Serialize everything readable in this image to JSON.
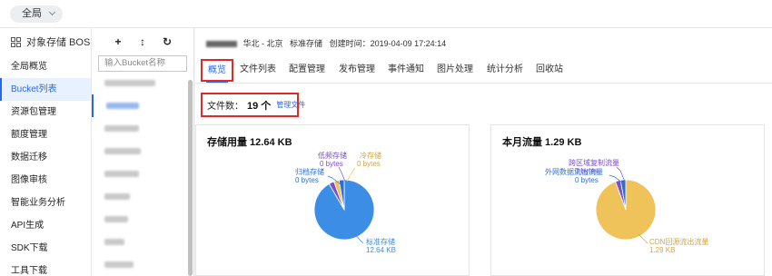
{
  "topbar": {
    "region": "全局"
  },
  "nav": {
    "title": "对象存储 BOS",
    "items": [
      {
        "label": "全局概览"
      },
      {
        "label": "Bucket列表"
      },
      {
        "label": "资源包管理"
      },
      {
        "label": "额度管理"
      },
      {
        "label": "数据迁移"
      },
      {
        "label": "图像审核"
      },
      {
        "label": "智能业务分析"
      },
      {
        "label": "API生成"
      },
      {
        "label": "SDK下载"
      },
      {
        "label": "工具下载"
      }
    ]
  },
  "bucket_panel": {
    "toolbar": {
      "add": "+",
      "sort": "↕",
      "refresh": "↻"
    },
    "search_placeholder": "输入Bucket名称"
  },
  "bucket_info": {
    "region": "华北 - 北京",
    "storage_class": "标准存储",
    "created": "创建时间：2019-04-09 17:24:14"
  },
  "tabs": [
    {
      "label": "概览"
    },
    {
      "label": "文件列表"
    },
    {
      "label": "配置管理"
    },
    {
      "label": "发布管理"
    },
    {
      "label": "事件通知"
    },
    {
      "label": "图片处理"
    },
    {
      "label": "统计分析"
    },
    {
      "label": "回收站"
    }
  ],
  "file_count": {
    "label": "文件数：",
    "value": "19 个",
    "link": "管理文件"
  },
  "colors": {
    "accent": "#2468f2",
    "highlight": "#e02a2a",
    "blue": "#3b8de6",
    "purple": "#7b4fc9",
    "gold": "#efc25a"
  },
  "chart_data": [
    {
      "type": "pie",
      "title": "存储用量 12.64 KB",
      "slices": [
        {
          "name": "标准存储",
          "value_label": "12.64 KB",
          "value": 12.64,
          "color": "#3b8de6"
        },
        {
          "name": "低频存储",
          "value_label": "0 bytes",
          "value": 0,
          "color": "#7b4fc9"
        },
        {
          "name": "冷存储",
          "value_label": "0 bytes",
          "value": 0,
          "color": "#efc25a"
        },
        {
          "name": "归档存储",
          "value_label": "0 bytes",
          "value": 0,
          "color": "#2c6fd1"
        }
      ]
    },
    {
      "type": "pie",
      "title": "本月流量 1.29 KB",
      "slices": [
        {
          "name": "CDN回源流出流量",
          "value_label": "1.29 KB",
          "value": 1.29,
          "color": "#efc25a"
        },
        {
          "name": "跨区域复制流量",
          "value_label": "0 bytes",
          "value": 0,
          "color": "#7b4fc9"
        },
        {
          "name": "外网数据流出流量",
          "value_label": "0 bytes",
          "value": 0,
          "color": "#2c6fd1"
        }
      ]
    }
  ]
}
